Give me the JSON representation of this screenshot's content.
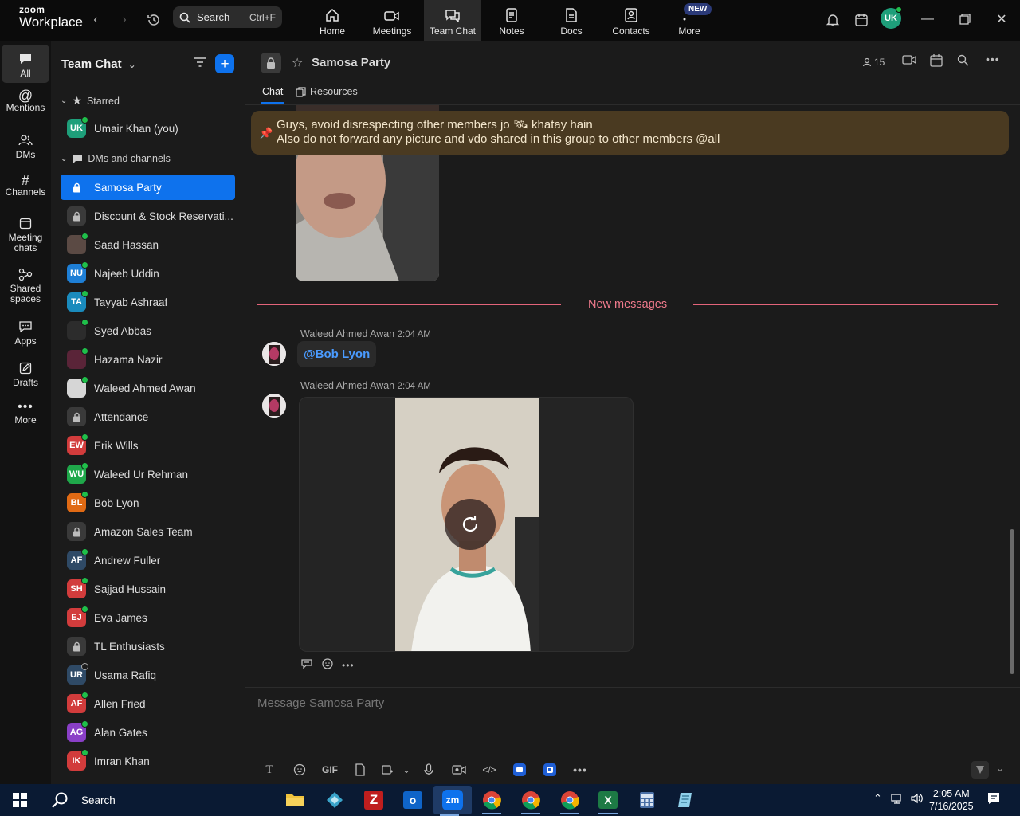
{
  "app": {
    "brand_small": "zoom",
    "brand_big": "Workplace"
  },
  "topbar": {
    "search_label": "Search",
    "search_shortcut": "Ctrl+F",
    "nav": [
      {
        "label": "Home",
        "icon": "home-icon"
      },
      {
        "label": "Meetings",
        "icon": "video-icon"
      },
      {
        "label": "Team Chat",
        "icon": "chat-icon"
      },
      {
        "label": "Notes",
        "icon": "notes-icon"
      },
      {
        "label": "Docs",
        "icon": "docs-icon"
      },
      {
        "label": "Contacts",
        "icon": "contacts-icon"
      },
      {
        "label": "More",
        "icon": "more-icon"
      }
    ],
    "new_badge": "NEW",
    "user_initials": "UK"
  },
  "rail": [
    {
      "label": "All"
    },
    {
      "label": "Mentions"
    },
    {
      "label": "DMs"
    },
    {
      "label": "Channels"
    },
    {
      "label": "Meeting chats"
    },
    {
      "label": "Shared spaces"
    },
    {
      "label": "Apps"
    },
    {
      "label": "Drafts"
    },
    {
      "label": "More"
    }
  ],
  "sidebar": {
    "title": "Team Chat",
    "starred_header": "Starred",
    "starred": [
      {
        "name": "Umair Khan (you)",
        "initials": "UK",
        "color": "#1e9f7a"
      }
    ],
    "dms_header": "DMs and channels",
    "items": [
      {
        "name": "Samosa Party",
        "kind": "lock"
      },
      {
        "name": "Discount & Stock Reservati...",
        "kind": "lock"
      },
      {
        "name": "Saad Hassan",
        "kind": "photo",
        "color": "#5b4a44"
      },
      {
        "name": "Najeeb Uddin",
        "initials": "NU",
        "color": "#1e7fd6"
      },
      {
        "name": "Tayyab Ashraaf",
        "initials": "TA",
        "color": "#1a8bbd"
      },
      {
        "name": "Syed Abbas",
        "kind": "photo",
        "color": "#2c2c2c"
      },
      {
        "name": "Hazama Nazir",
        "kind": "photo",
        "color": "#5a2438"
      },
      {
        "name": "Waleed Ahmed Awan",
        "kind": "photo",
        "color": "#d6d6d6"
      },
      {
        "name": "Attendance",
        "kind": "lock"
      },
      {
        "name": "Erik Wills",
        "initials": "EW",
        "color": "#d23c3c"
      },
      {
        "name": "Waleed Ur Rehman",
        "initials": "WU",
        "color": "#1fa84a"
      },
      {
        "name": "Bob Lyon",
        "initials": "BL",
        "color": "#e06a14"
      },
      {
        "name": "Amazon Sales Team",
        "kind": "lock"
      },
      {
        "name": "Andrew Fuller",
        "initials": "AF",
        "color": "#2f4a66"
      },
      {
        "name": "Sajjad Hussain",
        "initials": "SH",
        "color": "#d23c3c"
      },
      {
        "name": "Eva James",
        "initials": "EJ",
        "color": "#d23c3c"
      },
      {
        "name": "TL Enthusiasts",
        "kind": "lock"
      },
      {
        "name": "Usama Rafiq",
        "initials": "UR",
        "color": "#2f4a66"
      },
      {
        "name": "Allen Fried",
        "initials": "AF",
        "color": "#d23c3c"
      },
      {
        "name": "Alan Gates",
        "initials": "AG",
        "color": "#8a3fc7"
      },
      {
        "name": "Imran Khan",
        "initials": "IK",
        "color": "#d23c3c"
      }
    ]
  },
  "chat": {
    "channel_name": "Samosa Party",
    "member_count": "15",
    "tabs": [
      "Chat",
      "Resources"
    ],
    "pinned_line1": "Guys, avoid disrespecting other members jo 🛰 khatay hain",
    "pinned_line2": "Also do not forward any picture and vdo shared in this group to other members @all",
    "new_messages_label": "New messages",
    "messages": [
      {
        "sender": "Waleed Ahmed Awan",
        "time": "2:04 AM",
        "mention": "@Bob Lyon"
      },
      {
        "sender": "Waleed Ahmed Awan",
        "time": "2:04 AM"
      }
    ],
    "composer_placeholder": "Message Samosa Party",
    "gif_label": "GIF"
  },
  "taskbar": {
    "search_label": "Search",
    "time": "2:05 AM",
    "date": "7/16/2025"
  },
  "colors": {
    "accent": "#0e72ed",
    "pin_background": "#4a3a21",
    "new_messages": "#f07a8c",
    "online": "#1fbf4a"
  }
}
